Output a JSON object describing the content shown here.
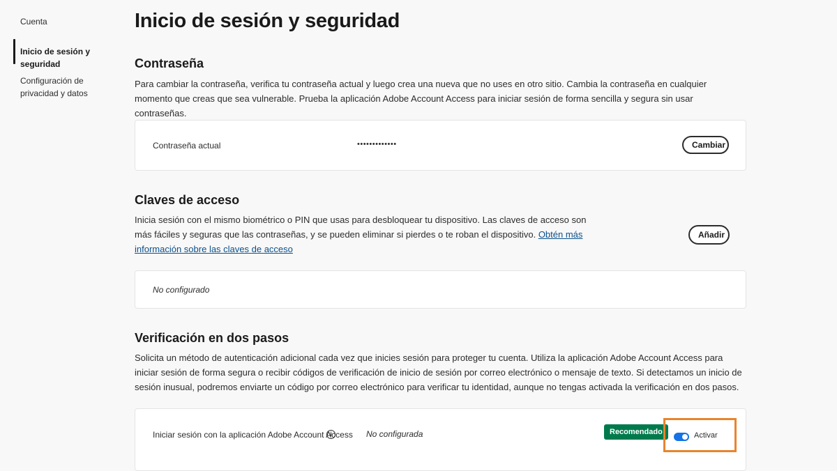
{
  "sidebar": {
    "items": [
      {
        "label": "Cuenta"
      },
      {
        "label": "Inicio de sesión y seguridad"
      },
      {
        "label": "Configuración de privacidad y datos"
      }
    ]
  },
  "page": {
    "title": "Inicio de sesión y seguridad"
  },
  "password": {
    "title": "Contraseña",
    "description": "Para cambiar la contraseña, verifica tu contraseña actual y luego crea una nueva que no uses en otro sitio. Cambia la contraseña en cualquier momento que creas que sea vulnerable. Prueba la aplicación Adobe Account Access para iniciar sesión de forma sencilla y segura sin usar contraseñas.",
    "current_label": "Contraseña actual",
    "masked_value": "•••••••••••••",
    "change_button": "Cambiar"
  },
  "passkeys": {
    "title": "Claves de acceso",
    "description": "Inicia sesión con el mismo biométrico o PIN que usas para desbloquear tu dispositivo. Las claves de acceso son más fáciles y seguras que las contraseñas, y se pueden eliminar si pierdes o te roban el dispositivo. ",
    "link_text": "Obtén más información sobre las claves de acceso",
    "add_button": "Añadir",
    "status": "No configurado"
  },
  "two_step": {
    "title": "Verificación en dos pasos",
    "description": "Solicita un método de autenticación adicional cada vez que inicies sesión para proteger tu cuenta. Utiliza la aplicación Adobe Account Access para iniciar sesión de forma segura o recibir códigos de verificación de inicio de sesión por correo electrónico o mensaje de texto. Si detectamos un inicio de sesión inusual, podremos enviarte un código por correo electrónico para verificar tu identidad, aunque no tengas activada la verificación en dos pasos.",
    "app_label": "Iniciar sesión con la aplicación Adobe Account Access",
    "info_glyph": "i",
    "app_status": "No configurada",
    "badge": "Recomendado",
    "toggle_label": "Activar",
    "toggle_on": true,
    "colors": {
      "toggle": "#1473e6",
      "badge": "#007a4d",
      "highlight": "#e8842c"
    }
  }
}
